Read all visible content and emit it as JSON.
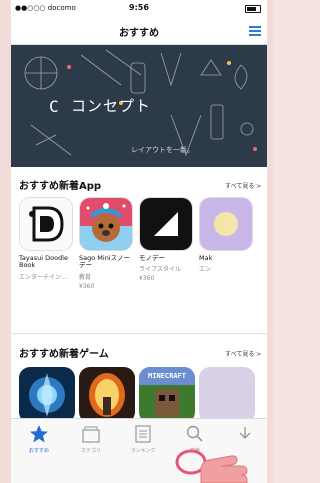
{
  "status": {
    "carrier": "●●○○○ docomo",
    "time": "9:56"
  },
  "nav": {
    "title": "おすすめ"
  },
  "banner": {
    "logo": "C",
    "title": "コンセプト",
    "caption": "レイアウトを一新。"
  },
  "apps_section": {
    "title": "おすすめ新着App",
    "more": "すべて見る >",
    "apps": [
      {
        "name": "Tayasui Doodle Book",
        "category": "エンターテイン…",
        "price": ""
      },
      {
        "name": "Sago Miniスノーデー",
        "category": "教育",
        "price": "¥360"
      },
      {
        "name": "モノデー",
        "category": "ライフスタイル",
        "price": "¥360"
      },
      {
        "name": "Mak",
        "category": "エン",
        "price": ""
      }
    ]
  },
  "games_section": {
    "title": "おすすめ新着ゲーム",
    "more": "すべて見る >",
    "games": [
      {
        "name": "",
        "art": "blue-crystal"
      },
      {
        "name": "",
        "art": "portal"
      },
      {
        "name": "MINECRAFT STORY MODE",
        "art": "minecraft"
      }
    ]
  },
  "tabs": [
    {
      "label": "おすすめ",
      "icon": "star-icon",
      "active": true
    },
    {
      "label": "カテゴリ",
      "icon": "categories-icon",
      "active": false
    },
    {
      "label": "ランキング",
      "icon": "ranking-icon",
      "active": false
    },
    {
      "label": "検索",
      "icon": "search-icon",
      "active": false
    },
    {
      "label": "",
      "icon": "updates-icon",
      "active": false
    }
  ],
  "colors": {
    "accent": "#1f6fd0",
    "banner_bg": "#2d3a4a",
    "frame_pink": "#f2dcd9"
  }
}
